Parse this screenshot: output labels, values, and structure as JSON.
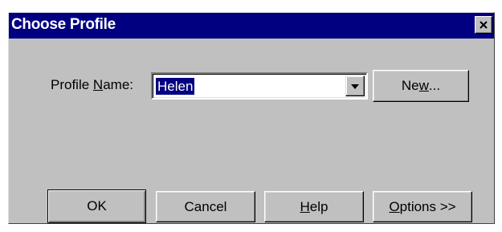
{
  "window": {
    "title": "Choose Profile",
    "close_icon": "close-icon"
  },
  "profile": {
    "label_pre": "Profile ",
    "label_mnemonic": "N",
    "label_post": "ame:",
    "value": "Helen",
    "dropdown_icon": "chevron-down-icon"
  },
  "buttons": {
    "new": {
      "pre": "Ne",
      "mnemonic": "w",
      "post": "..."
    },
    "ok": {
      "label": "OK"
    },
    "cancel": {
      "label": "Cancel"
    },
    "help": {
      "pre": "",
      "mnemonic": "H",
      "post": "elp"
    },
    "options": {
      "pre": "",
      "mnemonic": "O",
      "post": "ptions >>"
    }
  },
  "colors": {
    "titlebar": "#000080",
    "face": "#c0c0c0",
    "selection": "#000080"
  }
}
